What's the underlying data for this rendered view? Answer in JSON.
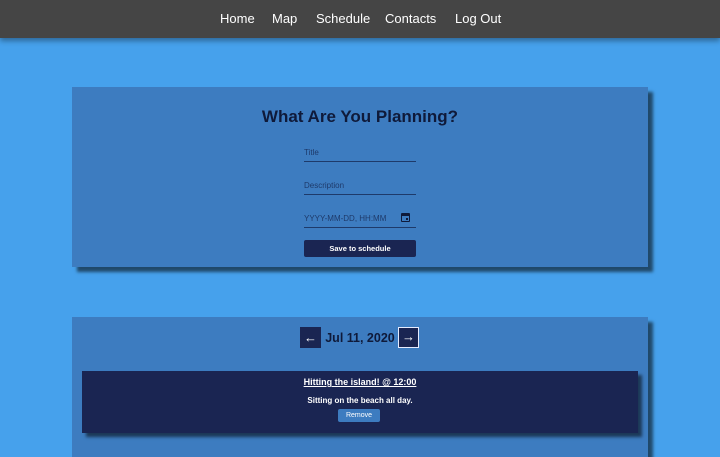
{
  "nav": {
    "home": "Home",
    "map": "Map",
    "schedule": "Schedule",
    "contacts": "Contacts",
    "logout": "Log Out"
  },
  "form": {
    "heading": "What Are You Planning?",
    "title_placeholder": "Title",
    "description_placeholder": "Description",
    "datetime_placeholder": "YYYY-MM-DD, HH:MM",
    "save_label": "Save to schedule"
  },
  "schedule": {
    "prev_arrow": "←",
    "next_arrow": "→",
    "date": "Jul 11, 2020",
    "events": [
      {
        "title": "Hitting the island! @ 12:00",
        "description": "Sitting on the beach all day.",
        "remove_label": "Remove"
      }
    ]
  },
  "colors": {
    "background": "#46a1ec",
    "topbar": "#454545",
    "card": "#3d7cc0",
    "dark_navy": "#1a2552"
  }
}
